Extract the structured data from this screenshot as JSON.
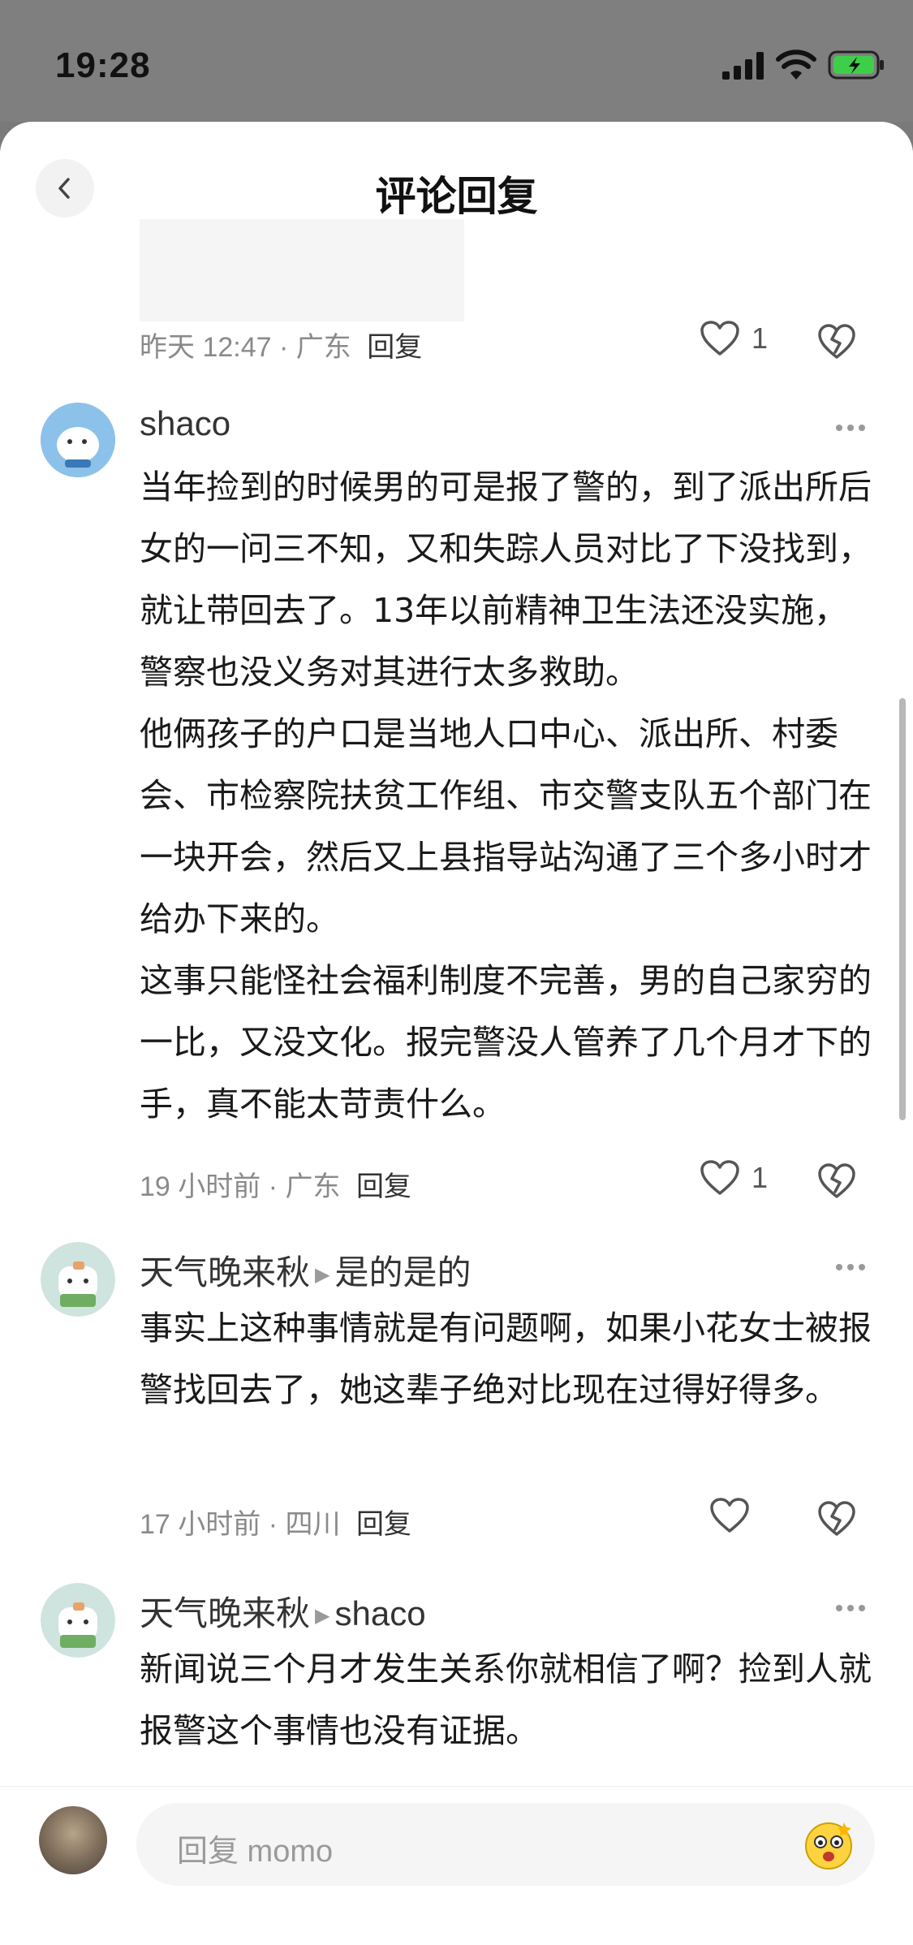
{
  "status_bar": {
    "time": "19:28"
  },
  "header": {
    "title": "评论回复"
  },
  "previous_comment": {
    "meta": "昨天 12:47 · 广东",
    "reply_label": "回复",
    "likes": "1"
  },
  "comments": [
    {
      "username": "shaco",
      "reply_to": "",
      "text": "当年捡到的时候男的可是报了警的，到了派出所后女的一问三不知，又和失踪人员对比了下没找到，就让带回去了。13年以前精神卫生法还没实施，警察也没义务对其进行太多救助。\n他俩孩子的户口是当地人口中心、派出所、村委会、市检察院扶贫工作组、市交警支队五个部门在一块开会，然后又上县指导站沟通了三个多小时才给办下来的。\n这事只能怪社会福利制度不完善，男的自己家穷的一比，又没文化。报完警没人管养了几个月才下的手，真不能太苛责什么。",
      "meta": "19 小时前 · 广东",
      "reply_label": "回复",
      "likes": "1"
    },
    {
      "username": "天气晚来秋",
      "reply_to": "是的是的",
      "text": "事实上这种事情就是有问题啊，如果小花女士被报警找回去了，她这辈子绝对比现在过得好得多。",
      "meta": "17 小时前 · 四川",
      "reply_label": "回复",
      "likes": ""
    },
    {
      "username": "天气晚来秋",
      "reply_to": "shaco",
      "text": "新闻说三个月才发生关系你就相信了啊？捡到人就报警这个事情也没有证据。",
      "meta": "",
      "reply_label": "",
      "likes": ""
    }
  ],
  "bottom_bar": {
    "placeholder": "回复 momo"
  },
  "icons": {
    "back": "chevron-left-icon",
    "like": "heart-icon",
    "dislike": "broken-heart-icon",
    "more": "more-dots-icon",
    "emoji": "emoji-face-icon"
  }
}
